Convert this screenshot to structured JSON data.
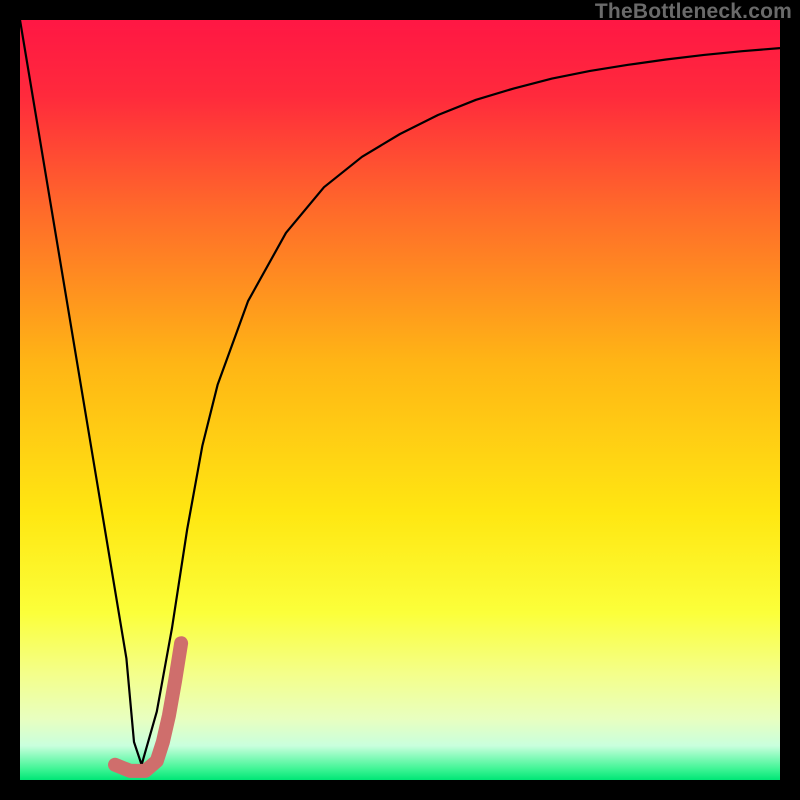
{
  "watermark": "TheBottleneck.com",
  "chart_data": {
    "type": "line",
    "title": "",
    "xlabel": "",
    "ylabel": "",
    "xlim": [
      0,
      100
    ],
    "ylim": [
      0,
      100
    ],
    "grid": false,
    "legend": false,
    "gradient_stops": [
      {
        "offset": 0.0,
        "color": "#ff1744"
      },
      {
        "offset": 0.1,
        "color": "#ff2a3c"
      },
      {
        "offset": 0.25,
        "color": "#ff6a2a"
      },
      {
        "offset": 0.45,
        "color": "#ffb515"
      },
      {
        "offset": 0.65,
        "color": "#ffe712"
      },
      {
        "offset": 0.78,
        "color": "#fbff3a"
      },
      {
        "offset": 0.86,
        "color": "#f4ff8a"
      },
      {
        "offset": 0.92,
        "color": "#e8ffc0"
      },
      {
        "offset": 0.955,
        "color": "#c9ffdd"
      },
      {
        "offset": 0.985,
        "color": "#41f596"
      },
      {
        "offset": 1.0,
        "color": "#00e676"
      }
    ],
    "series": [
      {
        "name": "bottleneck-curve",
        "color": "#000000",
        "stroke_width": 2.2,
        "x": [
          0,
          2,
          4,
          6,
          8,
          10,
          12,
          14,
          15,
          16,
          18,
          20,
          22,
          24,
          26,
          30,
          35,
          40,
          45,
          50,
          55,
          60,
          65,
          70,
          75,
          80,
          85,
          90,
          95,
          100
        ],
        "values": [
          100,
          88,
          76,
          64,
          52,
          40,
          28,
          16,
          5,
          2,
          9,
          20,
          33,
          44,
          52,
          63,
          72,
          78,
          82,
          85,
          87.5,
          89.5,
          91,
          92.3,
          93.3,
          94.1,
          94.8,
          95.4,
          95.9,
          96.3
        ]
      },
      {
        "name": "highlight-segment",
        "color": "#cf6e6c",
        "stroke_width": 14,
        "linecap": "round",
        "x": [
          12.5,
          14.5,
          16.5,
          18.0,
          18.8,
          19.6,
          20.4,
          21.2
        ],
        "values": [
          2.0,
          1.2,
          1.2,
          2.5,
          5.0,
          8.5,
          13.0,
          18.0
        ]
      }
    ]
  }
}
